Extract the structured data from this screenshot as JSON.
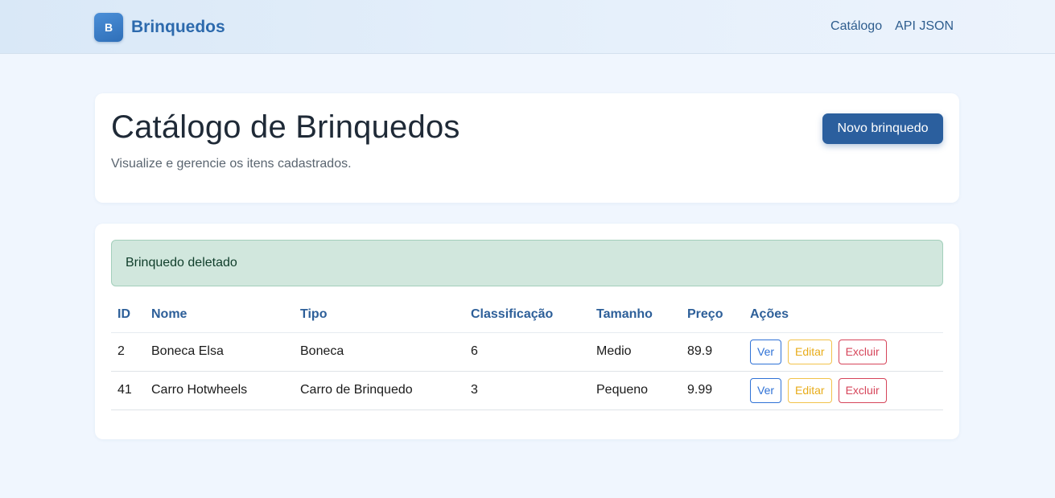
{
  "navbar": {
    "logo_letter": "B",
    "brand": "Brinquedos",
    "links": [
      "Catálogo",
      "API JSON"
    ]
  },
  "header": {
    "title": "Catálogo de Brinquedos",
    "subtitle": "Visualize e gerencie os itens cadastrados.",
    "new_button": "Novo brinquedo"
  },
  "alert": {
    "message": "Brinquedo deletado"
  },
  "table": {
    "columns": [
      "ID",
      "Nome",
      "Tipo",
      "Classificação",
      "Tamanho",
      "Preço",
      "Ações"
    ],
    "rows": [
      {
        "id": "2",
        "nome": "Boneca Elsa",
        "tipo": "Boneca",
        "classificacao": "6",
        "tamanho": "Medio",
        "preco": "89.9"
      },
      {
        "id": "41",
        "nome": "Carro Hotwheels",
        "tipo": "Carro de Brinquedo",
        "classificacao": "3",
        "tamanho": "Pequeno",
        "preco": "9.99"
      }
    ],
    "actions": {
      "view": "Ver",
      "edit": "Editar",
      "delete": "Excluir"
    }
  },
  "colors": {
    "brand": "#2d6aad",
    "primary_button": "#2b5f9e",
    "alert_bg": "#d1e7dd",
    "view": "#2f72d6",
    "edit": "#e8ac1a",
    "delete": "#d6455a"
  }
}
